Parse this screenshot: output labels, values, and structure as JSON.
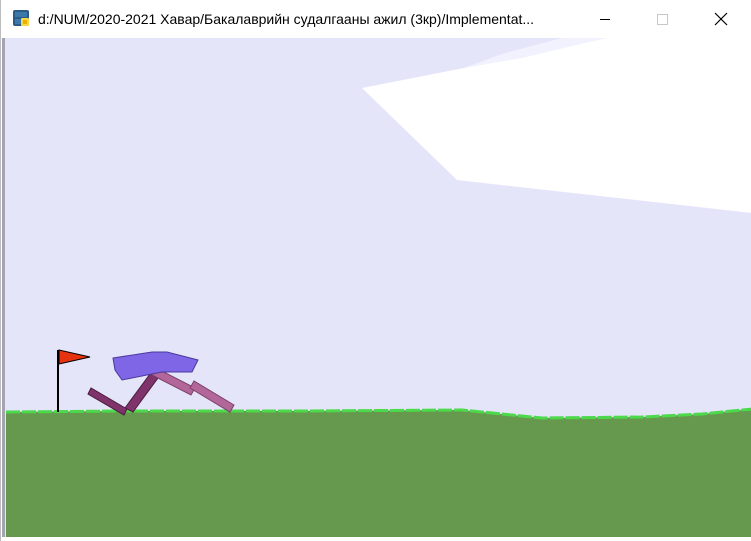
{
  "window": {
    "title": "d:/NUM/2020-2021 Хавар/Бакалаврийн судалгааны ажил (3кр)/Implementat...",
    "icon": "python-icon",
    "controls": [
      "minimize-icon",
      "maximize-icon",
      "close-icon"
    ]
  },
  "colors": {
    "sky": "#e5e5fa",
    "cloud": "#ffffff",
    "ground": "#66994d",
    "ground_edge": "#4cd94c",
    "flag": "#e6330f",
    "flag_pole": "#000000",
    "hull": "#7f66e6",
    "leg_near": "#b3669a",
    "leg_far": "#80336a"
  }
}
